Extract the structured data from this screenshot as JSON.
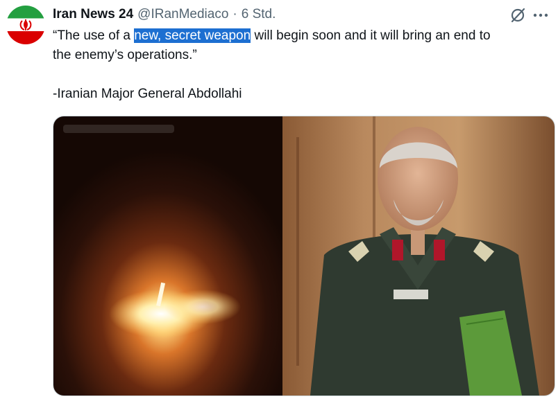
{
  "tweet": {
    "display_name": "Iran News 24",
    "handle": "@IRanMediaco",
    "separator": "·",
    "time": "6 Std.",
    "text_before": "“The use of a ",
    "text_highlight": "new, secret weapon",
    "text_after": " will begin soon and it will bring an end to",
    "text_line2": "the enemy’s operations.”",
    "signature": "-Iranian Major General Abdollahi"
  },
  "icons": {
    "avatar": "iran-flag-avatar",
    "grok": "grok-slash-icon",
    "more": "more-horizontal-icon"
  },
  "media": {
    "left_image": "night-missile-launch-photo",
    "right_image": "general-in-uniform-photo"
  },
  "colors": {
    "highlight": "#1d6fd1",
    "text": "#0f1419",
    "secondary": "#536471"
  }
}
